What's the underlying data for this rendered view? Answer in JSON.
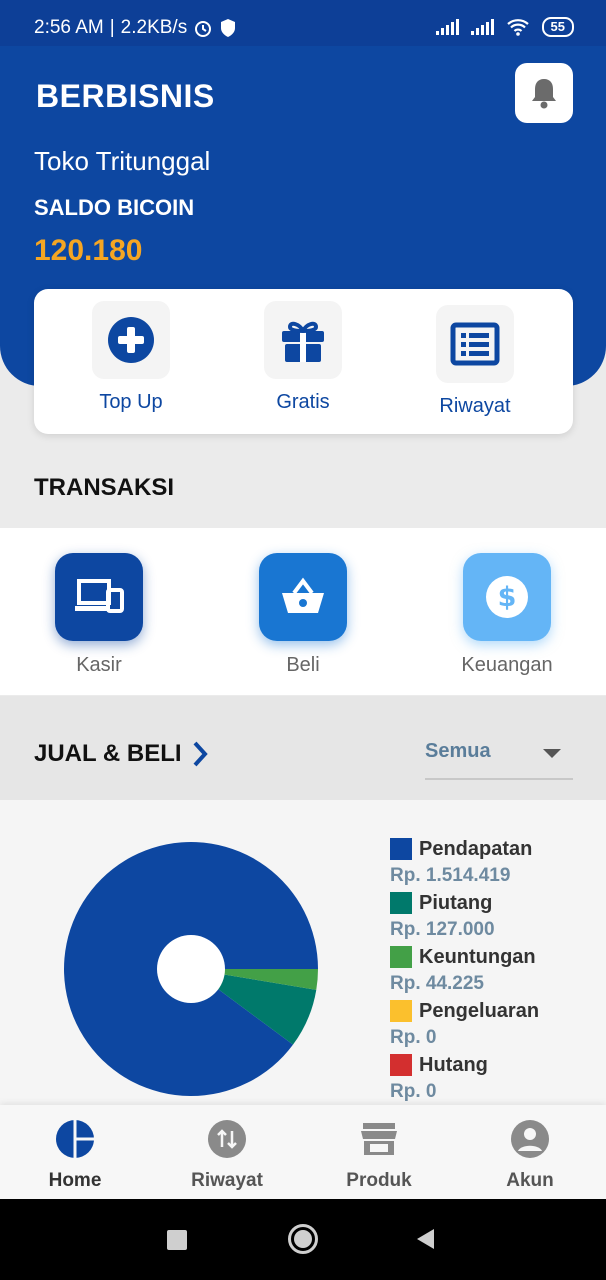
{
  "status_bar": {
    "time": "2:56 AM",
    "speed": "2.2KB/s",
    "battery": "55"
  },
  "header": {
    "brand": "BERBISNIS",
    "store_name": "Toko Tritunggal",
    "saldo_label": "SALDO BICOIN",
    "saldo_value": "120.180"
  },
  "quick_actions": [
    {
      "label": "Top Up",
      "icon": "plus-circle-icon"
    },
    {
      "label": "Gratis",
      "icon": "gift-icon"
    },
    {
      "label": "Riwayat",
      "icon": "list-icon"
    }
  ],
  "transaksi": {
    "title": "TRANSAKSI",
    "items": [
      {
        "label": "Kasir",
        "icon": "devices-icon",
        "color": "#0d47a1"
      },
      {
        "label": "Beli",
        "icon": "basket-icon",
        "color": "#1976d2"
      },
      {
        "label": "Keuangan",
        "icon": "dollar-icon",
        "color": "#64b5f6"
      }
    ]
  },
  "jual_beli": {
    "title": "JUAL & BELI",
    "filter_value": "Semua"
  },
  "chart_data": {
    "type": "pie",
    "donut": true,
    "slices": [
      {
        "label": "Pendapatan",
        "value": 1514419,
        "display": "Rp. 1.514.419",
        "color": "#0d47a1"
      },
      {
        "label": "Piutang",
        "value": 127000,
        "display": "Rp. 127.000",
        "color": "#00796b"
      },
      {
        "label": "Keuntungan",
        "value": 44225,
        "display": "Rp. 44.225",
        "color": "#43a047"
      },
      {
        "label": "Pengeluaran",
        "value": 0,
        "display": "Rp. 0",
        "color": "#fbc02d"
      },
      {
        "label": "Hutang",
        "value": 0,
        "display": "Rp. 0",
        "color": "#d32f2f"
      }
    ]
  },
  "bottom_nav": [
    {
      "label": "Home",
      "icon": "home-pie-icon",
      "active": true
    },
    {
      "label": "Riwayat",
      "icon": "transfer-icon",
      "active": false
    },
    {
      "label": "Produk",
      "icon": "store-icon",
      "active": false
    },
    {
      "label": "Akun",
      "icon": "account-icon",
      "active": false
    }
  ],
  "colors": {
    "primary": "#0d47a1",
    "accent": "#f5a623",
    "inactive": "#777777"
  }
}
